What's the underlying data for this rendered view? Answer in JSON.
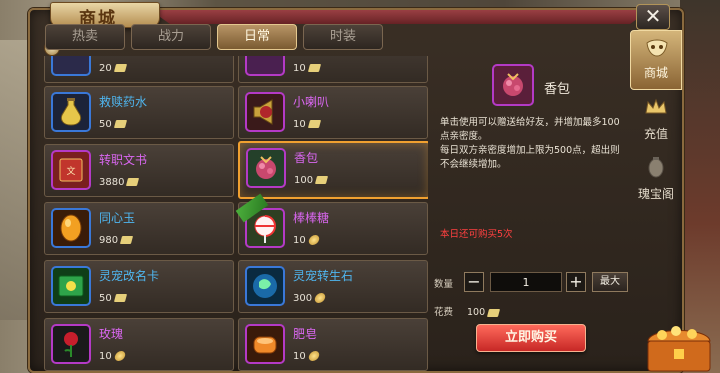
{
  "window": {
    "title": "商城",
    "close_label": "✕"
  },
  "tabs": [
    {
      "label": "热卖",
      "active": false
    },
    {
      "label": "战力",
      "active": false
    },
    {
      "label": "日常",
      "active": true
    },
    {
      "label": "时装",
      "active": false
    }
  ],
  "items": [
    {
      "name": "",
      "price": "20",
      "currency": "coupon-icon"
    },
    {
      "name": "",
      "price": "10",
      "currency": "coupon-icon"
    },
    {
      "name": "救赎药水",
      "price": "50",
      "currency": "coupon-icon"
    },
    {
      "name": "小喇叭",
      "price": "10",
      "currency": "coupon-icon"
    },
    {
      "name": "转职文书",
      "price": "3880",
      "currency": "coupon-icon"
    },
    {
      "name": "香包",
      "price": "100",
      "currency": "coupon-icon",
      "selected": true
    },
    {
      "name": "同心玉",
      "price": "980",
      "currency": "coupon-icon"
    },
    {
      "name": "棒棒糖",
      "price": "10",
      "currency": "gold-coin-icon"
    },
    {
      "name": "灵宠改名卡",
      "price": "50",
      "currency": "coupon-icon"
    },
    {
      "name": "灵宠转生石",
      "price": "300",
      "currency": "gold-coin-icon"
    },
    {
      "name": "玫瑰",
      "price": "10",
      "currency": "gold-coin-icon"
    },
    {
      "name": "肥皂",
      "price": "10",
      "currency": "gold-coin-icon"
    }
  ],
  "detail": {
    "name": "香包",
    "description_line1": "单击使用可以赠送给好友，并增加最多100点亲密度。",
    "description_line2": "每日双方亲密度增加上限为500点，超出则不会继续增加。",
    "daily_limit": "本日还可购买5次",
    "quantity_label": "数量",
    "minus": "−",
    "quantity": "1",
    "plus": "+",
    "max_label": "最大",
    "cost_label": "花费",
    "cost_value": "100",
    "buy_label": "立即购买"
  },
  "side_nav": [
    {
      "label": "商城",
      "icon": "mask-icon",
      "active": true
    },
    {
      "label": "充值",
      "icon": "crown-icon",
      "active": false
    },
    {
      "label": "瑰宝阁",
      "icon": "lantern-icon",
      "active": false
    }
  ],
  "colors": {
    "selected_border": "#f0a030",
    "name_blue": "#4fb6f0",
    "name_purple": "#d967f0",
    "limit_red": "#ff4040",
    "buy_button": "#e03a33"
  }
}
